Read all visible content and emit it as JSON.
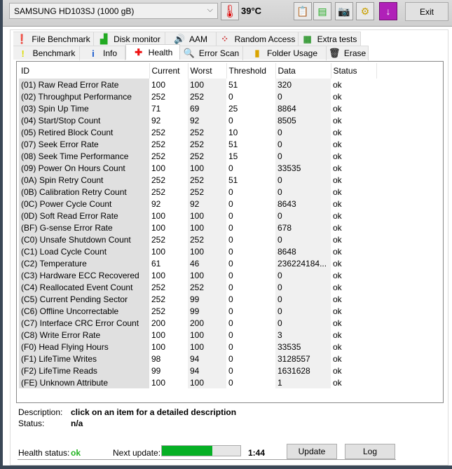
{
  "drive": {
    "selected": "SAMSUNG HD103SJ (1000 gB)"
  },
  "temperature": "39°C",
  "toolbar": {
    "icons": [
      "copy-text-icon",
      "copy-image-icon",
      "screenshot-camera-icon",
      "options-icon",
      "save-down-icon"
    ],
    "exit_label": "Exit"
  },
  "tabs_row1": [
    {
      "label": "File Benchmark",
      "icon": "file-benchmark-icon"
    },
    {
      "label": "Disk monitor",
      "icon": "bar-chart-icon"
    },
    {
      "label": "AAM",
      "icon": "speaker-icon"
    },
    {
      "label": "Random Access",
      "icon": "scatter-icon"
    },
    {
      "label": "Extra tests",
      "icon": "extra-tests-icon"
    }
  ],
  "tabs_row2": [
    {
      "label": "Benchmark",
      "icon": "exclamation-icon"
    },
    {
      "label": "Info",
      "icon": "info-icon"
    },
    {
      "label": "Health",
      "icon": "red-cross-icon",
      "active": true
    },
    {
      "label": "Error Scan",
      "icon": "magnifier-icon"
    },
    {
      "label": "Folder Usage",
      "icon": "folder-icon"
    },
    {
      "label": "Erase",
      "icon": "trash-icon"
    }
  ],
  "table": {
    "columns": [
      "ID",
      "Current",
      "Worst",
      "Threshold",
      "Data",
      "Status"
    ],
    "rows": [
      [
        "(01) Raw Read Error Rate",
        "100",
        "100",
        "51",
        "320",
        "ok"
      ],
      [
        "(02) Throughput Performance",
        "252",
        "252",
        "0",
        "0",
        "ok"
      ],
      [
        "(03) Spin Up Time",
        "71",
        "69",
        "25",
        "8864",
        "ok"
      ],
      [
        "(04) Start/Stop Count",
        "92",
        "92",
        "0",
        "8505",
        "ok"
      ],
      [
        "(05) Retired Block Count",
        "252",
        "252",
        "10",
        "0",
        "ok"
      ],
      [
        "(07) Seek Error Rate",
        "252",
        "252",
        "51",
        "0",
        "ok"
      ],
      [
        "(08) Seek Time Performance",
        "252",
        "252",
        "15",
        "0",
        "ok"
      ],
      [
        "(09) Power On Hours Count",
        "100",
        "100",
        "0",
        "33535",
        "ok"
      ],
      [
        "(0A) Spin Retry Count",
        "252",
        "252",
        "51",
        "0",
        "ok"
      ],
      [
        "(0B) Calibration Retry Count",
        "252",
        "252",
        "0",
        "0",
        "ok"
      ],
      [
        "(0C) Power Cycle Count",
        "92",
        "92",
        "0",
        "8643",
        "ok"
      ],
      [
        "(0D) Soft Read Error Rate",
        "100",
        "100",
        "0",
        "0",
        "ok"
      ],
      [
        "(BF) G-sense Error Rate",
        "100",
        "100",
        "0",
        "678",
        "ok"
      ],
      [
        "(C0) Unsafe Shutdown Count",
        "252",
        "252",
        "0",
        "0",
        "ok"
      ],
      [
        "(C1) Load Cycle Count",
        "100",
        "100",
        "0",
        "8648",
        "ok"
      ],
      [
        "(C2) Temperature",
        "61",
        "46",
        "0",
        "236224184...",
        "ok"
      ],
      [
        "(C3) Hardware ECC Recovered",
        "100",
        "100",
        "0",
        "0",
        "ok"
      ],
      [
        "(C4) Reallocated Event Count",
        "252",
        "252",
        "0",
        "0",
        "ok"
      ],
      [
        "(C5) Current Pending Sector",
        "252",
        "99",
        "0",
        "0",
        "ok"
      ],
      [
        "(C6) Offline Uncorrectable",
        "252",
        "99",
        "0",
        "0",
        "ok"
      ],
      [
        "(C7) Interface CRC Error Count",
        "200",
        "200",
        "0",
        "0",
        "ok"
      ],
      [
        "(C8) Write Error Rate",
        "100",
        "100",
        "0",
        "3",
        "ok"
      ],
      [
        "(F0) Head Flying Hours",
        "100",
        "100",
        "0",
        "33535",
        "ok"
      ],
      [
        "(F1) LifeTime Writes",
        "98",
        "94",
        "0",
        "3128557",
        "ok"
      ],
      [
        "(F2) LifeTime Reads",
        "99",
        "94",
        "0",
        "1631628",
        "ok"
      ],
      [
        "(FE) Unknown Attribute",
        "100",
        "100",
        "0",
        "1",
        "ok"
      ]
    ]
  },
  "description": {
    "label": "Description:",
    "value": "click on an item for a detailed description"
  },
  "status": {
    "label": "Status:",
    "value": "n/a"
  },
  "health": {
    "label": "Health status:",
    "value": "ok",
    "color": "#22b422"
  },
  "next_update": {
    "label": "Next update:",
    "progress_percent": 64,
    "time": "1:44",
    "color": "#06b025"
  },
  "buttons": {
    "update": "Update",
    "log": "Log"
  }
}
